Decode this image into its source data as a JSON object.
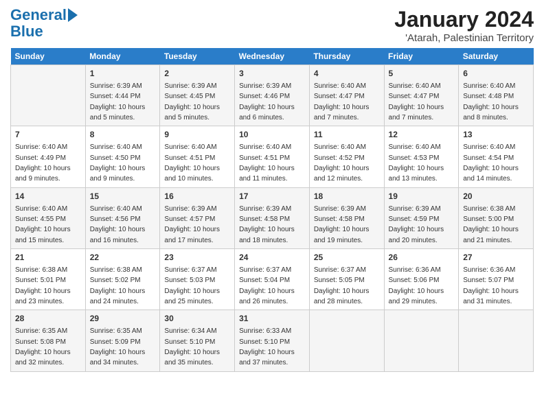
{
  "logo": {
    "line1": "General",
    "line2": "Blue"
  },
  "title": "January 2024",
  "subtitle": "'Atarah, Palestinian Territory",
  "days_of_week": [
    "Sunday",
    "Monday",
    "Tuesday",
    "Wednesday",
    "Thursday",
    "Friday",
    "Saturday"
  ],
  "weeks": [
    [
      {
        "num": "",
        "sunrise": "",
        "sunset": "",
        "daylight": ""
      },
      {
        "num": "1",
        "sunrise": "Sunrise: 6:39 AM",
        "sunset": "Sunset: 4:44 PM",
        "daylight": "Daylight: 10 hours and 5 minutes."
      },
      {
        "num": "2",
        "sunrise": "Sunrise: 6:39 AM",
        "sunset": "Sunset: 4:45 PM",
        "daylight": "Daylight: 10 hours and 5 minutes."
      },
      {
        "num": "3",
        "sunrise": "Sunrise: 6:39 AM",
        "sunset": "Sunset: 4:46 PM",
        "daylight": "Daylight: 10 hours and 6 minutes."
      },
      {
        "num": "4",
        "sunrise": "Sunrise: 6:40 AM",
        "sunset": "Sunset: 4:47 PM",
        "daylight": "Daylight: 10 hours and 7 minutes."
      },
      {
        "num": "5",
        "sunrise": "Sunrise: 6:40 AM",
        "sunset": "Sunset: 4:47 PM",
        "daylight": "Daylight: 10 hours and 7 minutes."
      },
      {
        "num": "6",
        "sunrise": "Sunrise: 6:40 AM",
        "sunset": "Sunset: 4:48 PM",
        "daylight": "Daylight: 10 hours and 8 minutes."
      }
    ],
    [
      {
        "num": "7",
        "sunrise": "Sunrise: 6:40 AM",
        "sunset": "Sunset: 4:49 PM",
        "daylight": "Daylight: 10 hours and 9 minutes."
      },
      {
        "num": "8",
        "sunrise": "Sunrise: 6:40 AM",
        "sunset": "Sunset: 4:50 PM",
        "daylight": "Daylight: 10 hours and 9 minutes."
      },
      {
        "num": "9",
        "sunrise": "Sunrise: 6:40 AM",
        "sunset": "Sunset: 4:51 PM",
        "daylight": "Daylight: 10 hours and 10 minutes."
      },
      {
        "num": "10",
        "sunrise": "Sunrise: 6:40 AM",
        "sunset": "Sunset: 4:51 PM",
        "daylight": "Daylight: 10 hours and 11 minutes."
      },
      {
        "num": "11",
        "sunrise": "Sunrise: 6:40 AM",
        "sunset": "Sunset: 4:52 PM",
        "daylight": "Daylight: 10 hours and 12 minutes."
      },
      {
        "num": "12",
        "sunrise": "Sunrise: 6:40 AM",
        "sunset": "Sunset: 4:53 PM",
        "daylight": "Daylight: 10 hours and 13 minutes."
      },
      {
        "num": "13",
        "sunrise": "Sunrise: 6:40 AM",
        "sunset": "Sunset: 4:54 PM",
        "daylight": "Daylight: 10 hours and 14 minutes."
      }
    ],
    [
      {
        "num": "14",
        "sunrise": "Sunrise: 6:40 AM",
        "sunset": "Sunset: 4:55 PM",
        "daylight": "Daylight: 10 hours and 15 minutes."
      },
      {
        "num": "15",
        "sunrise": "Sunrise: 6:40 AM",
        "sunset": "Sunset: 4:56 PM",
        "daylight": "Daylight: 10 hours and 16 minutes."
      },
      {
        "num": "16",
        "sunrise": "Sunrise: 6:39 AM",
        "sunset": "Sunset: 4:57 PM",
        "daylight": "Daylight: 10 hours and 17 minutes."
      },
      {
        "num": "17",
        "sunrise": "Sunrise: 6:39 AM",
        "sunset": "Sunset: 4:58 PM",
        "daylight": "Daylight: 10 hours and 18 minutes."
      },
      {
        "num": "18",
        "sunrise": "Sunrise: 6:39 AM",
        "sunset": "Sunset: 4:58 PM",
        "daylight": "Daylight: 10 hours and 19 minutes."
      },
      {
        "num": "19",
        "sunrise": "Sunrise: 6:39 AM",
        "sunset": "Sunset: 4:59 PM",
        "daylight": "Daylight: 10 hours and 20 minutes."
      },
      {
        "num": "20",
        "sunrise": "Sunrise: 6:38 AM",
        "sunset": "Sunset: 5:00 PM",
        "daylight": "Daylight: 10 hours and 21 minutes."
      }
    ],
    [
      {
        "num": "21",
        "sunrise": "Sunrise: 6:38 AM",
        "sunset": "Sunset: 5:01 PM",
        "daylight": "Daylight: 10 hours and 23 minutes."
      },
      {
        "num": "22",
        "sunrise": "Sunrise: 6:38 AM",
        "sunset": "Sunset: 5:02 PM",
        "daylight": "Daylight: 10 hours and 24 minutes."
      },
      {
        "num": "23",
        "sunrise": "Sunrise: 6:37 AM",
        "sunset": "Sunset: 5:03 PM",
        "daylight": "Daylight: 10 hours and 25 minutes."
      },
      {
        "num": "24",
        "sunrise": "Sunrise: 6:37 AM",
        "sunset": "Sunset: 5:04 PM",
        "daylight": "Daylight: 10 hours and 26 minutes."
      },
      {
        "num": "25",
        "sunrise": "Sunrise: 6:37 AM",
        "sunset": "Sunset: 5:05 PM",
        "daylight": "Daylight: 10 hours and 28 minutes."
      },
      {
        "num": "26",
        "sunrise": "Sunrise: 6:36 AM",
        "sunset": "Sunset: 5:06 PM",
        "daylight": "Daylight: 10 hours and 29 minutes."
      },
      {
        "num": "27",
        "sunrise": "Sunrise: 6:36 AM",
        "sunset": "Sunset: 5:07 PM",
        "daylight": "Daylight: 10 hours and 31 minutes."
      }
    ],
    [
      {
        "num": "28",
        "sunrise": "Sunrise: 6:35 AM",
        "sunset": "Sunset: 5:08 PM",
        "daylight": "Daylight: 10 hours and 32 minutes."
      },
      {
        "num": "29",
        "sunrise": "Sunrise: 6:35 AM",
        "sunset": "Sunset: 5:09 PM",
        "daylight": "Daylight: 10 hours and 34 minutes."
      },
      {
        "num": "30",
        "sunrise": "Sunrise: 6:34 AM",
        "sunset": "Sunset: 5:10 PM",
        "daylight": "Daylight: 10 hours and 35 minutes."
      },
      {
        "num": "31",
        "sunrise": "Sunrise: 6:33 AM",
        "sunset": "Sunset: 5:10 PM",
        "daylight": "Daylight: 10 hours and 37 minutes."
      },
      {
        "num": "",
        "sunrise": "",
        "sunset": "",
        "daylight": ""
      },
      {
        "num": "",
        "sunrise": "",
        "sunset": "",
        "daylight": ""
      },
      {
        "num": "",
        "sunrise": "",
        "sunset": "",
        "daylight": ""
      }
    ]
  ]
}
